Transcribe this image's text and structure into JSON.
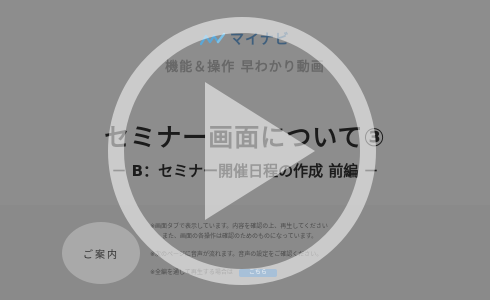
{
  "logo": {
    "brand": "マイナビ",
    "icon": "mynavi-logo-icon"
  },
  "video": {
    "subtitle": "機能＆操作 早わかり動画",
    "title": "セミナー画面について③",
    "heading": "－ B：セミナー開催日程の作成 前編 －"
  },
  "guide": {
    "label": "ご案内",
    "notes": [
      "※画面タブで表示しています。内容を確認の上、再生してください",
      "　また、画面の各操作は確認のためのものになっています。",
      "※次のページに音声が流れます。音声の設定をご確認ください。",
      "※全編を通して再生する場合は"
    ],
    "here_button": "こちら"
  },
  "player": {
    "icon": "play-icon",
    "overlay_color": "#ffffff"
  }
}
